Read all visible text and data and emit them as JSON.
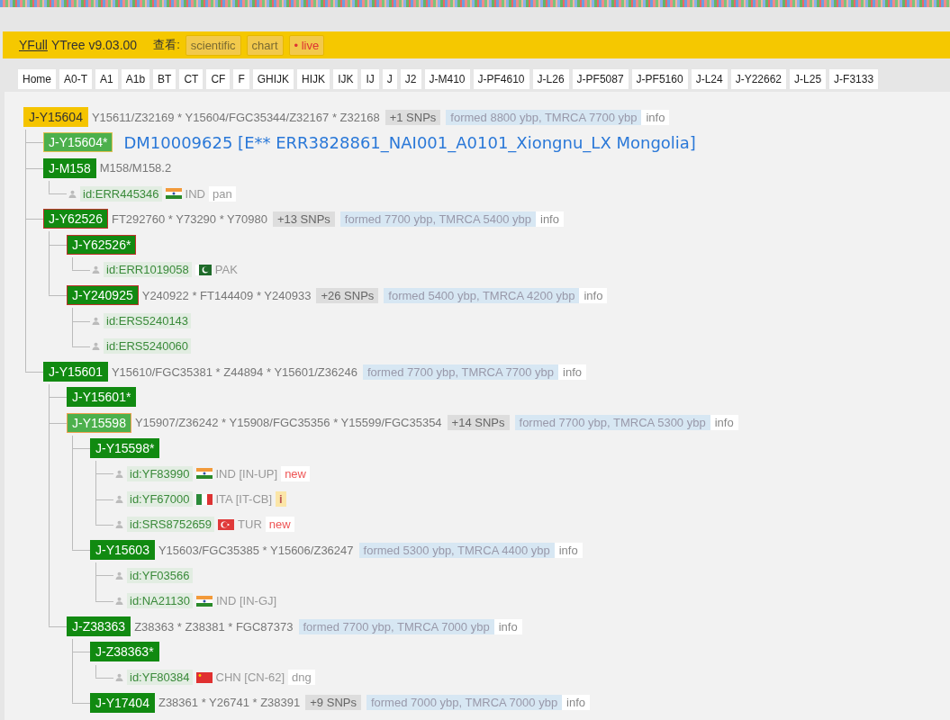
{
  "header": {
    "brand_link": "YFull",
    "title": "YTree v9.03.00",
    "view_label": "查看:",
    "view_buttons": [
      {
        "label": "scientific",
        "kind": "plain"
      },
      {
        "label": "chart",
        "kind": "plain"
      },
      {
        "label": "• live",
        "kind": "live"
      }
    ]
  },
  "tabs": [
    {
      "label": "Home",
      "selected": false
    },
    {
      "label": "A0-T",
      "selected": false
    },
    {
      "label": "A1",
      "selected": false
    },
    {
      "label": "A1b",
      "selected": false
    },
    {
      "label": "BT",
      "selected": false
    },
    {
      "label": "CT",
      "selected": false
    },
    {
      "label": "CF",
      "selected": false
    },
    {
      "label": "F",
      "selected": false
    },
    {
      "label": "GHIJK",
      "selected": false
    },
    {
      "label": "HIJK",
      "selected": false
    },
    {
      "label": "IJK",
      "selected": false
    },
    {
      "label": "IJ",
      "selected": false
    },
    {
      "label": "J",
      "selected": false
    },
    {
      "label": "J2",
      "selected": false
    },
    {
      "label": "J-M410",
      "selected": false
    },
    {
      "label": "J-PF4610",
      "selected": false
    },
    {
      "label": "J-L26",
      "selected": false
    },
    {
      "label": "J-PF5087",
      "selected": false
    },
    {
      "label": "J-PF5160",
      "selected": false
    },
    {
      "label": "J-L24",
      "selected": false
    },
    {
      "label": "J-Y22662",
      "selected": false
    },
    {
      "label": "J-L25",
      "selected": false
    },
    {
      "label": "J-F3133",
      "selected": false
    }
  ],
  "tree": {
    "kind": "root",
    "label": "J-Y15604",
    "snps": "Y15611/Z32169 * Y15604/FGC35344/Z32167 * Z32168",
    "extra_snps": "+1 SNPs",
    "age": "formed 8800 ybp, TMRCA 7700 ybp",
    "info": "info",
    "children": [
      {
        "kind": "current",
        "label": "J-Y15604*",
        "note": "DM10009625 [E** ERR3828861_NAI001_A0101_Xiongnu_LX Mongolia]"
      },
      {
        "kind": "clade",
        "label": "J-M158",
        "snps": "M158/M158.2",
        "children": [
          {
            "kind": "sample",
            "id": "id:ERR445346",
            "flag": {
              "kind": "india"
            },
            "country": "IND",
            "tag": {
              "text": "pan",
              "kind": "plain"
            }
          }
        ]
      },
      {
        "kind": "marked",
        "label": "J-Y62526",
        "snps": "FT292760 * Y73290 * Y70980",
        "extra_snps": "+13 SNPs",
        "age": "formed 7700 ybp, TMRCA 5400 ybp",
        "info": "info",
        "children": [
          {
            "kind": "marked",
            "label": "J-Y62526*",
            "children": [
              {
                "kind": "sample",
                "id": "id:ERR1019058",
                "flag": {
                  "kind": "pakistan"
                },
                "country": "PAK"
              }
            ]
          },
          {
            "kind": "marked",
            "label": "J-Y240925",
            "snps": "Y240922 * FT144409 * Y240933",
            "extra_snps": "+26 SNPs",
            "age": "formed 5400 ybp, TMRCA 4200 ybp",
            "info": "info",
            "children": [
              {
                "kind": "sample",
                "id": "id:ERS5240143"
              },
              {
                "kind": "sample",
                "id": "id:ERS5240060"
              }
            ]
          }
        ]
      },
      {
        "kind": "clade",
        "label": "J-Y15601",
        "snps": "Y15610/FGC35381 * Z44894 * Y15601/Z36246",
        "age": "formed 7700 ybp, TMRCA 7700 ybp",
        "info": "info",
        "children": [
          {
            "kind": "clade",
            "label": "J-Y15601*"
          },
          {
            "kind": "hovered",
            "label": "J-Y15598",
            "snps": "Y15907/Z36242 * Y15908/FGC35356 * Y15599/FGC35354",
            "extra_snps": "+14 SNPs",
            "age": "formed 7700 ybp, TMRCA 5300 ybp",
            "info": "info",
            "children": [
              {
                "kind": "clade",
                "label": "J-Y15598*",
                "children": [
                  {
                    "kind": "sample",
                    "id": "id:YF83990",
                    "flag": {
                      "kind": "india"
                    },
                    "country": "IND [IN-UP]",
                    "tag": {
                      "text": "new",
                      "kind": "new"
                    }
                  },
                  {
                    "kind": "sample",
                    "id": "id:YF67000",
                    "flag": {
                      "kind": "italy"
                    },
                    "country": "ITA [IT-CB]",
                    "tag": {
                      "text": "i",
                      "kind": "info"
                    }
                  },
                  {
                    "kind": "sample",
                    "id": "id:SRS8752659",
                    "flag": {
                      "kind": "turkey"
                    },
                    "country": "TUR",
                    "tag": {
                      "text": "new",
                      "kind": "new"
                    }
                  }
                ]
              },
              {
                "kind": "clade",
                "label": "J-Y15603",
                "snps": "Y15603/FGC35385 * Y15606/Z36247",
                "age": "formed 5300 ybp, TMRCA 4400 ybp",
                "info": "info",
                "children": [
                  {
                    "kind": "sample",
                    "id": "id:YF03566"
                  },
                  {
                    "kind": "sample",
                    "id": "id:NA21130",
                    "flag": {
                      "kind": "india"
                    },
                    "country": "IND [IN-GJ]"
                  }
                ]
              }
            ]
          },
          {
            "kind": "clade",
            "label": "J-Z38363",
            "snps": "Z38363 * Z38381 * FGC87373",
            "age": "formed 7700 ybp, TMRCA 7000 ybp",
            "info": "info",
            "children": [
              {
                "kind": "clade",
                "label": "J-Z38363*",
                "children": [
                  {
                    "kind": "sample",
                    "id": "id:YF80384",
                    "flag": {
                      "kind": "china"
                    },
                    "country": "CHN [CN-62]",
                    "tag": {
                      "text": "dng",
                      "kind": "plain"
                    }
                  }
                ]
              },
              {
                "kind": "clade",
                "label": "J-Y17404",
                "snps": "Z38361 * Y26741 * Z38391",
                "extra_snps": "+9 SNPs",
                "age": "formed 7000 ybp, TMRCA 7000 ybp",
                "info": "info"
              }
            ]
          }
        ]
      }
    ]
  }
}
